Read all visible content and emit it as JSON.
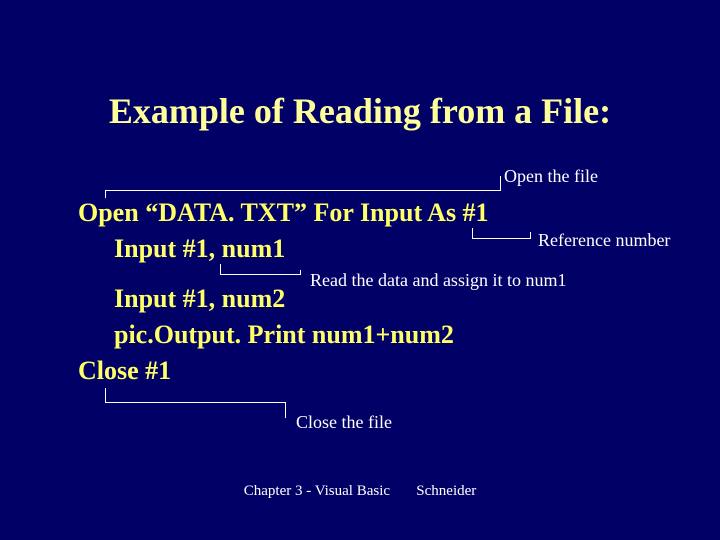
{
  "title": "Example of Reading from a File:",
  "code": {
    "open_kw": "Open",
    "open_rest": " “DATA. TXT” For Input As #1",
    "input1": "Input #1, num1",
    "input2": "Input #1, num2",
    "print": "pic.Output. Print num1+num2",
    "close": "Close #1"
  },
  "annotations": {
    "open_file": "Open the file",
    "ref_number": "Reference number",
    "read_assign": "Read the data and assign it to num1",
    "close_file": "Close the file"
  },
  "footer": {
    "left": "Chapter 3 - Visual Basic",
    "right": "Schneider"
  }
}
